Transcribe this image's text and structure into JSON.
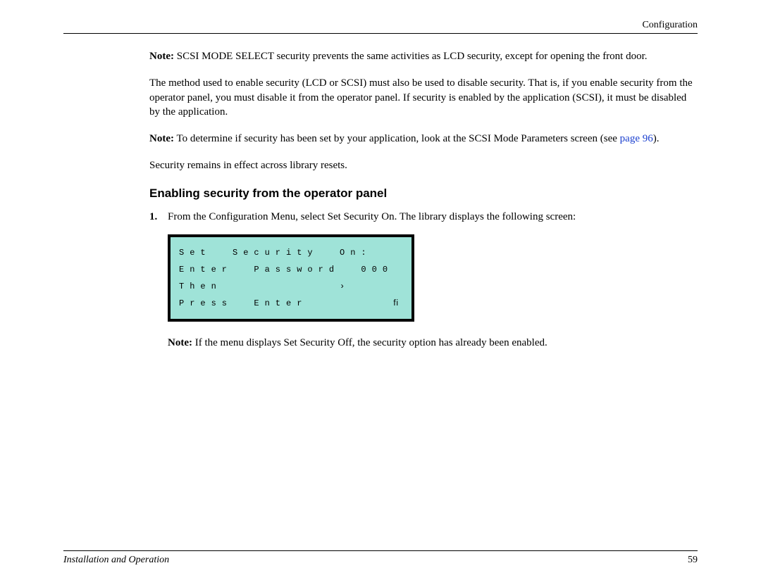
{
  "header": {
    "section": "Configuration"
  },
  "note1": {
    "label": "Note:",
    "text": "SCSI MODE SELECT security prevents the same activities as LCD security, except for opening the front door."
  },
  "para1": "The method used to enable security (LCD or SCSI) must also be used to disable security. That is, if you enable security from the operator panel, you must disable it from the operator panel. If security is enabled by the application (SCSI), it must be disabled by the application.",
  "note2": {
    "label": "Note:",
    "text_a": "To determine if security has been set by your application, look at the SCSI Mode Parameters screen (see ",
    "link": "page 96",
    "text_b": ")."
  },
  "para2": "Security remains in effect across library resets.",
  "subheading": "Enabling security from the operator panel",
  "step1": {
    "num": "1.",
    "text": "From the Configuration Menu, select Set Security On. The library displays the following screen:"
  },
  "lcd": {
    "line1": "Set  Security  On:",
    "line2": "Enter  Password  000",
    "line3": "Then           ›",
    "line4": "Press  Enter        ﬁ"
  },
  "note3": {
    "label": "Note:",
    "text": "If the menu displays Set Security Off, the security option has already been enabled."
  },
  "footer": {
    "left": "Installation and Operation",
    "page": "59"
  }
}
